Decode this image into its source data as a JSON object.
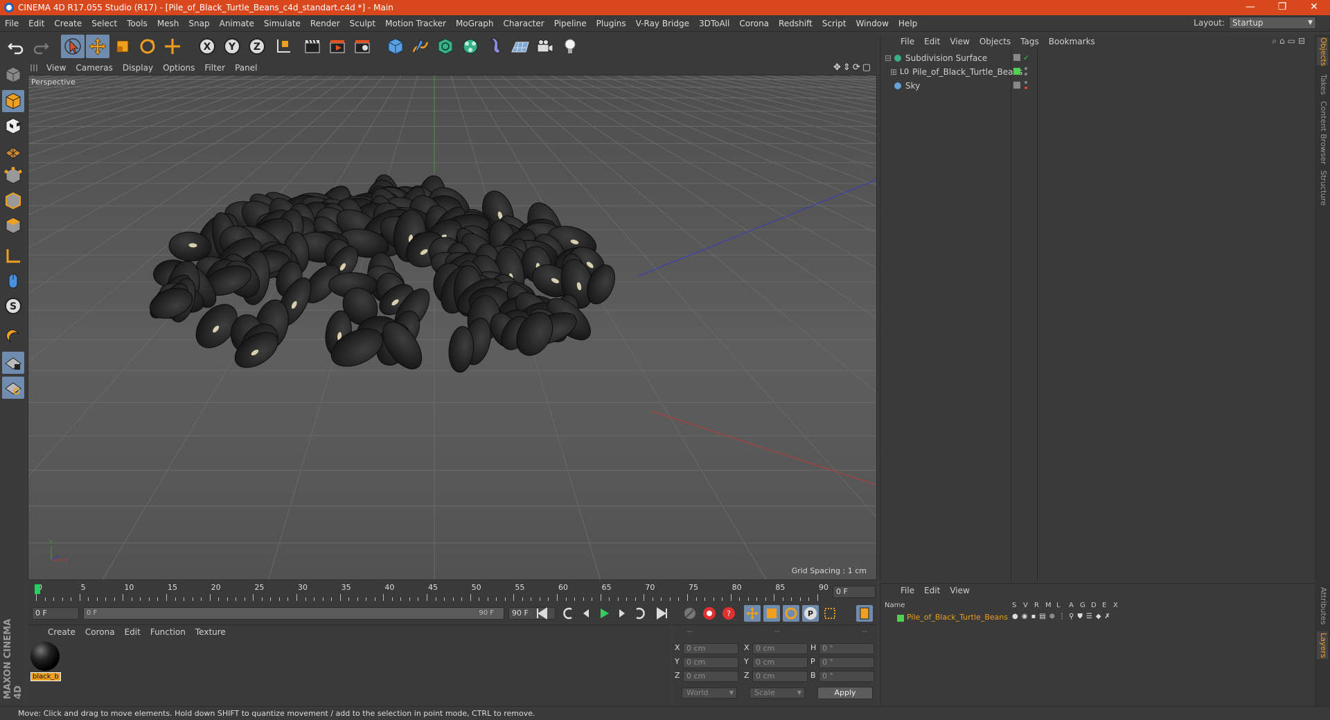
{
  "window": {
    "title": "CINEMA 4D R17.055 Studio (R17) - [Pile_of_Black_Turtle_Beans_c4d_standart.c4d *] - Main",
    "min": "—",
    "max": "❐",
    "close": "✕"
  },
  "menu": [
    "File",
    "Edit",
    "Create",
    "Select",
    "Tools",
    "Mesh",
    "Snap",
    "Animate",
    "Simulate",
    "Render",
    "Sculpt",
    "Motion Tracker",
    "MoGraph",
    "Character",
    "Pipeline",
    "Plugins",
    "V-Ray Bridge",
    "3DToAll",
    "Corona",
    "Redshift",
    "Script",
    "Window",
    "Help"
  ],
  "layout": {
    "label": "Layout:",
    "value": "Startup"
  },
  "viewport": {
    "menu": [
      "View",
      "Cameras",
      "Display",
      "Options",
      "Filter",
      "Panel"
    ],
    "camera_label": "Perspective",
    "grid_spacing": "Grid Spacing : 1 cm"
  },
  "timeline": {
    "ticks": [
      "0",
      "5",
      "10",
      "15",
      "20",
      "25",
      "30",
      "35",
      "40",
      "45",
      "50",
      "55",
      "60",
      "65",
      "70",
      "75",
      "80",
      "85",
      "90"
    ],
    "current_frame": "0 F",
    "start_field": "0 F",
    "range_start": "0 F",
    "range_end": "90 F",
    "end_field": "90 F"
  },
  "materials": {
    "menu": [
      "Create",
      "Corona",
      "Edit",
      "Function",
      "Texture"
    ],
    "items": [
      {
        "name": "black_b"
      }
    ]
  },
  "coords": {
    "headers": [
      "--",
      "--",
      "--"
    ],
    "rows": [
      {
        "a": "X",
        "av": "0 cm",
        "b": "X",
        "bv": "0 cm",
        "c": "H",
        "cv": "0 °"
      },
      {
        "a": "Y",
        "av": "0 cm",
        "b": "Y",
        "bv": "0 cm",
        "c": "P",
        "cv": "0 °"
      },
      {
        "a": "Z",
        "av": "0 cm",
        "b": "Z",
        "bv": "0 cm",
        "c": "B",
        "cv": "0 °"
      }
    ],
    "mode": "World",
    "transform": "Scale",
    "apply": "Apply"
  },
  "object_manager": {
    "menu": [
      "File",
      "Edit",
      "View",
      "Objects",
      "Tags",
      "Bookmarks"
    ],
    "objects": [
      {
        "name": "Subdivision Surface",
        "color": "#d0d0d0"
      },
      {
        "name": "Pile_of_Black_Turtle_Beans",
        "color": "#d0d0d0"
      },
      {
        "name": "Sky",
        "color": "#d0d0d0"
      }
    ]
  },
  "layer_manager": {
    "menu": [
      "File",
      "Edit",
      "View"
    ],
    "columns": [
      "Name",
      "S",
      "V",
      "R",
      "M",
      "L",
      "A",
      "G",
      "D",
      "E",
      "X"
    ],
    "layers": [
      {
        "name": "Pile_of_Black_Turtle_Beans",
        "color": "#e8a020"
      }
    ]
  },
  "side_tabs": [
    "Objects",
    "Takes",
    "Content Browser",
    "Structure"
  ],
  "side_tabs_lower": [
    "Attributes",
    "Layers"
  ],
  "status": "Move: Click and drag to move elements. Hold down SHIFT to quantize movement / add to the selection in point mode, CTRL to remove.",
  "logo": "MAXON CINEMA 4D"
}
